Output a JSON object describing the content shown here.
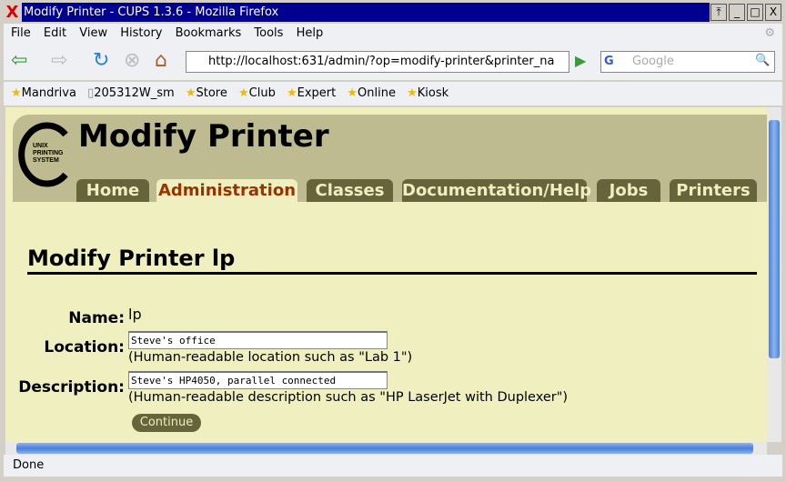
{
  "window": {
    "title": "Modify Printer - CUPS 1.3.6 - Mozilla Firefox"
  },
  "menu": [
    "File",
    "Edit",
    "View",
    "History",
    "Bookmarks",
    "Tools",
    "Help"
  ],
  "nav": {
    "url": "http://localhost:631/admin/?op=modify-printer&printer_na",
    "search_placeholder": "Google"
  },
  "bookmarks": [
    "Mandriva",
    "205312W_sm",
    "Store",
    "Club",
    "Expert",
    "Online",
    "Kiosk"
  ],
  "page": {
    "logo_text": "UNIX PRINTING SYSTEM",
    "title": "Modify Printer",
    "tabs": [
      "Home",
      "Administration",
      "Classes",
      "Documentation/Help",
      "Jobs",
      "Printers"
    ],
    "active_tab": "Administration",
    "heading": "Modify Printer lp",
    "form": {
      "name_label": "Name:",
      "name_value": "lp",
      "location_label": "Location:",
      "location_value": "Steve's office",
      "location_hint": "(Human-readable location such as \"Lab 1\")",
      "description_label": "Description:",
      "description_value": "Steve's HP4050, parallel connected",
      "description_hint": "(Human-readable description such as \"HP LaserJet with Duplexer\")",
      "continue_label": "Continue"
    }
  },
  "status": "Done"
}
